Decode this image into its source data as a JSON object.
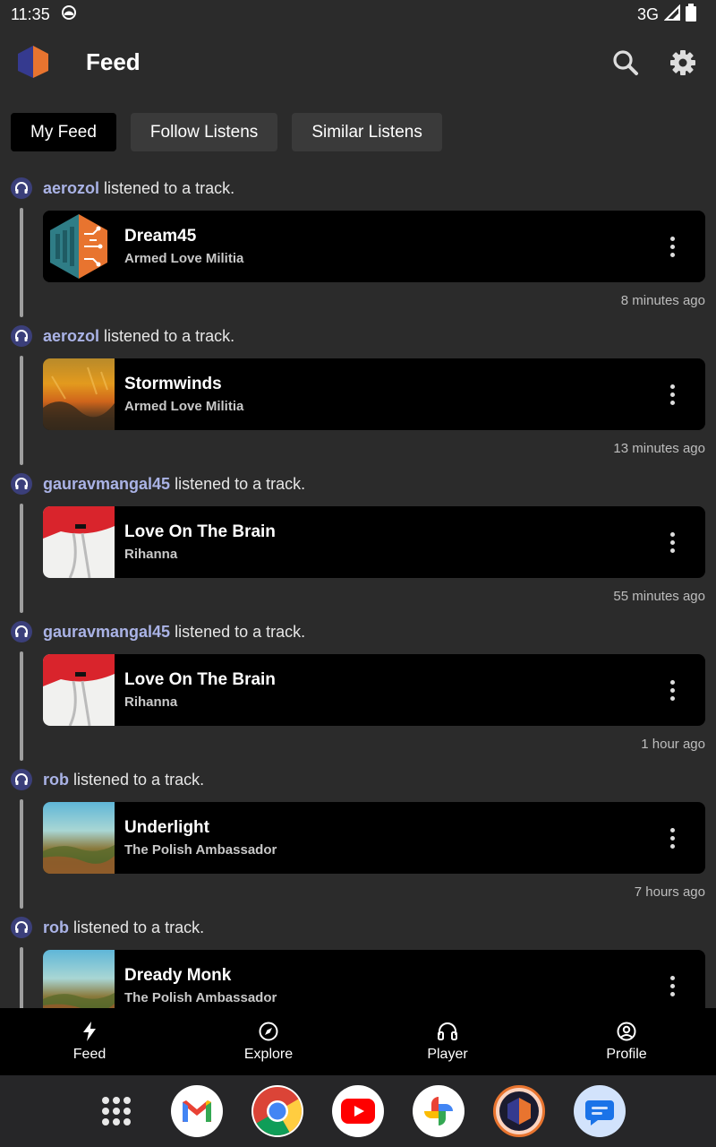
{
  "status_bar": {
    "time": "11:35",
    "network": "3G"
  },
  "app_bar": {
    "title": "Feed"
  },
  "filters": [
    {
      "label": "My Feed",
      "active": true
    },
    {
      "label": "Follow Listens",
      "active": false
    },
    {
      "label": "Similar Listens",
      "active": false
    }
  ],
  "feed": [
    {
      "user": "aerozol",
      "action": "listened to a track.",
      "title": "Dream45",
      "artist": "Armed Love Militia",
      "time": "8 minutes ago",
      "cover": "brain-logo"
    },
    {
      "user": "aerozol",
      "action": "listened to a track.",
      "title": "Stormwinds",
      "artist": "Armed Love Militia",
      "time": "13 minutes ago",
      "cover": "stormwinds-art"
    },
    {
      "user": "gauravmangal45",
      "action": "listened to a track.",
      "title": "Love On The Brain",
      "artist": "Rihanna",
      "time": "55 minutes ago",
      "cover": "anti-art"
    },
    {
      "user": "gauravmangal45",
      "action": "listened to a track.",
      "title": "Love On The Brain",
      "artist": "Rihanna",
      "time": "1 hour ago",
      "cover": "anti-art"
    },
    {
      "user": "rob",
      "action": "listened to a track.",
      "title": "Underlight",
      "artist": "The Polish Ambassador",
      "time": "7 hours ago",
      "cover": "ecozoic-art"
    },
    {
      "user": "rob",
      "action": "listened to a track.",
      "title": "Dready Monk",
      "artist": "The Polish Ambassador",
      "time": "",
      "cover": "ecozoic-art"
    }
  ],
  "bottom_nav": [
    {
      "label": "Feed",
      "icon": "bolt-icon"
    },
    {
      "label": "Explore",
      "icon": "compass-icon"
    },
    {
      "label": "Player",
      "icon": "headphones-icon"
    },
    {
      "label": "Profile",
      "icon": "profile-icon"
    }
  ],
  "dock": [
    "app-drawer",
    "gmail",
    "chrome",
    "youtube",
    "photos",
    "listenbrainz",
    "messages"
  ],
  "colors": {
    "background": "#2b2b2b",
    "card": "#000000",
    "username": "#aab3e6",
    "accent_orange": "#e8742f",
    "accent_indigo": "#3b3f7a"
  }
}
